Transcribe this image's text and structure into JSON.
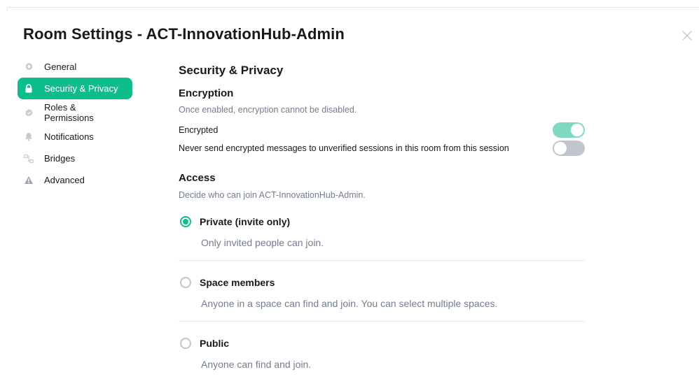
{
  "dialog": {
    "title": "Room Settings - ACT-InnovationHub-Admin"
  },
  "sidebar": {
    "items": [
      {
        "label": "General",
        "icon": "gear-icon",
        "active": false
      },
      {
        "label": "Security & Privacy",
        "icon": "lock-icon",
        "active": true
      },
      {
        "label": "Roles & Permissions",
        "icon": "badge-icon",
        "active": false
      },
      {
        "label": "Notifications",
        "icon": "bell-icon",
        "active": false
      },
      {
        "label": "Bridges",
        "icon": "bridge-icon",
        "active": false
      },
      {
        "label": "Advanced",
        "icon": "warning-icon",
        "active": false
      }
    ]
  },
  "security": {
    "title": "Security & Privacy",
    "encryption": {
      "heading": "Encryption",
      "description": "Once enabled, encryption cannot be disabled.",
      "encrypted_label": "Encrypted",
      "encrypted_on": true,
      "unverified_label": "Never send encrypted messages to unverified sessions in this room from this session",
      "unverified_on": false
    },
    "access": {
      "heading": "Access",
      "description": "Decide who can join ACT-InnovationHub-Admin.",
      "options": [
        {
          "label": "Private (invite only)",
          "description": "Only invited people can join.",
          "checked": true
        },
        {
          "label": "Space members",
          "description": "Anyone in a space can find and join. You can select multiple spaces.",
          "checked": false
        },
        {
          "label": "Public",
          "description": "Anyone can find and join.",
          "checked": false
        }
      ]
    }
  },
  "colors": {
    "accent": "#0dbd8b",
    "toggle_on": "#7fd9c0",
    "toggle_off": "#c1c6cd",
    "muted_text": "#737d8c"
  }
}
